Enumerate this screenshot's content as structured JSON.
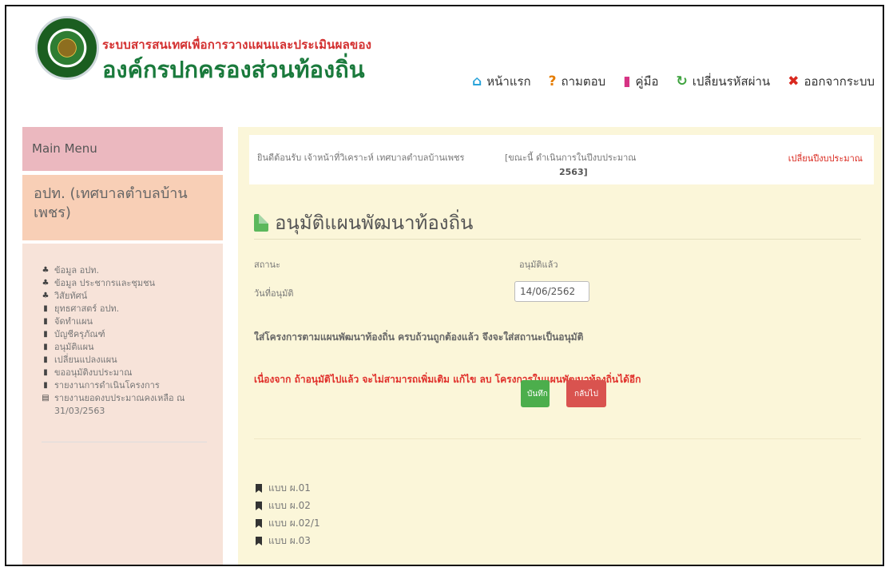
{
  "header": {
    "brand_line1": "ระบบสารสนเทศเพื่อการวางแผนและประเมินผลของ",
    "brand_line2": "องค์กรปกครองส่วนท้องถิ่น",
    "nav": [
      {
        "label": "หน้าแรก",
        "icon": "home-icon"
      },
      {
        "label": "ถามตอบ",
        "icon": "question-icon"
      },
      {
        "label": "คู่มือ",
        "icon": "book-icon"
      },
      {
        "label": "เปลี่ยนรหัสผ่าน",
        "icon": "refresh-icon"
      },
      {
        "label": "ออกจากระบบ",
        "icon": "close-icon"
      }
    ]
  },
  "sidebar": {
    "main_menu": "Main Menu",
    "org": "อปท. (เทศบาลตำบลบ้านเพชร)",
    "items": [
      {
        "label": "ข้อมูล อปท.",
        "icon": "sitemap-icon"
      },
      {
        "label": "ข้อมูล ประชากรและชุมชน",
        "icon": "sitemap-icon"
      },
      {
        "label": "วิสัยทัศน์",
        "icon": "sitemap-icon"
      },
      {
        "label": "ยุทธศาสตร์ อปท.",
        "icon": "bookmark-icon"
      },
      {
        "label": "จัดทำแผน",
        "icon": "bookmark-icon"
      },
      {
        "label": "บัญชีครุภัณฑ์",
        "icon": "bookmark-icon"
      },
      {
        "label": "อนุมัติแผน",
        "icon": "bookmark-icon"
      },
      {
        "label": "เปลี่ยนแปลงแผน",
        "icon": "bookmark-icon"
      },
      {
        "label": "ขออนุมัติงบประมาณ",
        "icon": "bookmark-icon"
      },
      {
        "label": "รายงานการดำเนินโครงการ",
        "icon": "bookmark-icon"
      },
      {
        "label": "รายงานยอดงบประมาณคงเหลือ ณ 31/03/2563",
        "icon": "file-icon"
      }
    ]
  },
  "info_bar": {
    "welcome": "ยินดีต้อนรับ เจ้าหน้าที่วิเคราะห์ เทศบาลตำบลบ้านเพชร",
    "status_prefix": "[ขณะนี้ ดำเนินการในปีงบประมาณ",
    "year": "2563]",
    "change_year": "เปลี่ยนปีงบประมาณ"
  },
  "page": {
    "title": "อนุมัติแผนพัฒนาท้องถิ่น",
    "status_label": "สถานะ",
    "status_value": "อนุมัติแล้ว",
    "date_label": "วันที่อนุมัติ",
    "date_value": "14/06/2562",
    "note": "ใส่โครงการตามแผนพัฒนาท้องถิ่น ครบถ้วนถูกต้องแล้ว จึงจะใส่สถานะเป็นอนุมัติ",
    "warning": "เนื่องจาก ถ้าอนุมัติไปแล้ว จะไม่สามารถเพิ่มเติม แก้ไข ลบ โครงการในแผนพัฒนาท้องถิ่นได้อีก",
    "save_label": "บันทึก",
    "back_label": "กลับไป"
  },
  "forms": [
    {
      "label": "แบบ ผ.01"
    },
    {
      "label": "แบบ ผ.02"
    },
    {
      "label": "แบบ ผ.02/1"
    },
    {
      "label": "แบบ ผ.03"
    }
  ],
  "colors": {
    "brand_red": "#d32f2f",
    "brand_green": "#1a7a3c",
    "content_bg": "#fbf6d9",
    "save_green": "#4cae4c",
    "back_red": "#d9534f"
  }
}
